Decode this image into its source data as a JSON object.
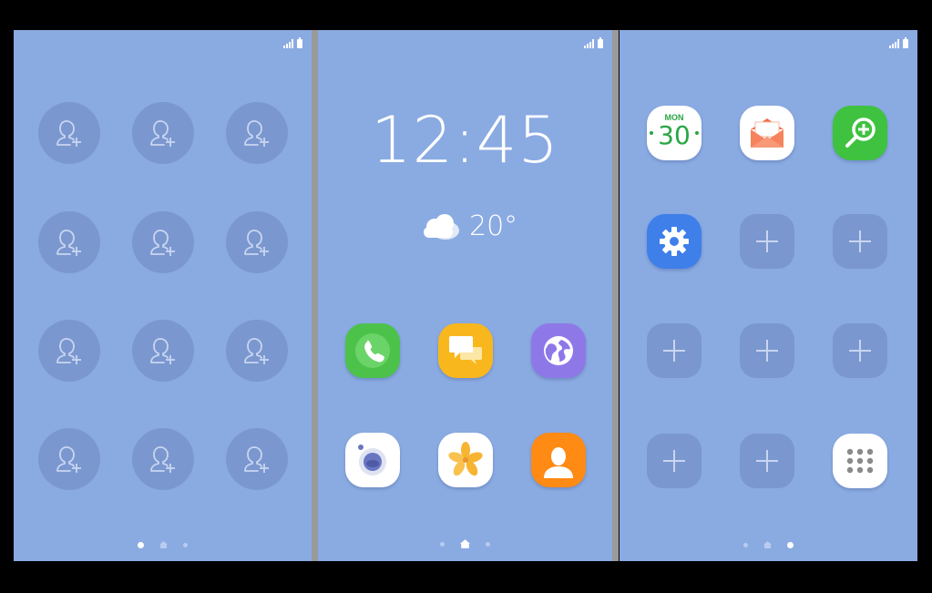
{
  "screens": {
    "left": {
      "type": "favourite-contacts",
      "slots": 12,
      "page_indicator": {
        "count": 3,
        "active": 0
      }
    },
    "center": {
      "clock": "12:45",
      "weather": {
        "temperature": "20°",
        "icon": "cloud-icon"
      },
      "apps": [
        {
          "name": "phone-app",
          "icon": "phone-icon",
          "color": "#4cc24a"
        },
        {
          "name": "messages-app",
          "icon": "chat-bubbles-icon",
          "color": "#f9b71e"
        },
        {
          "name": "internet-app",
          "icon": "globe-icon",
          "color": "#8e78e8"
        },
        {
          "name": "camera-app",
          "icon": "camera-icon",
          "color": "#ffffff"
        },
        {
          "name": "gallery-app",
          "icon": "flower-icon",
          "color": "#ffffff"
        },
        {
          "name": "contacts-app",
          "icon": "person-icon",
          "color": "#ff8a14"
        }
      ],
      "page_indicator": {
        "count": 3,
        "active": 1
      }
    },
    "right": {
      "calendar": {
        "day": "MON",
        "date": "30"
      },
      "apps": [
        {
          "name": "calendar-app",
          "icon": "calendar-icon",
          "color": "#ffffff"
        },
        {
          "name": "email-app",
          "icon": "envelope-icon",
          "color": "#ffffff"
        },
        {
          "name": "magnifier-app",
          "icon": "zoom-in-icon",
          "color": "#3fc23f"
        },
        {
          "name": "settings-app",
          "icon": "gear-icon",
          "color": "#3f7fea"
        },
        {
          "name": "apps-drawer",
          "icon": "app-grid-icon",
          "color": "#ffffff"
        }
      ],
      "empty_slots": 7,
      "page_indicator": {
        "count": 3,
        "active": 2
      }
    }
  }
}
